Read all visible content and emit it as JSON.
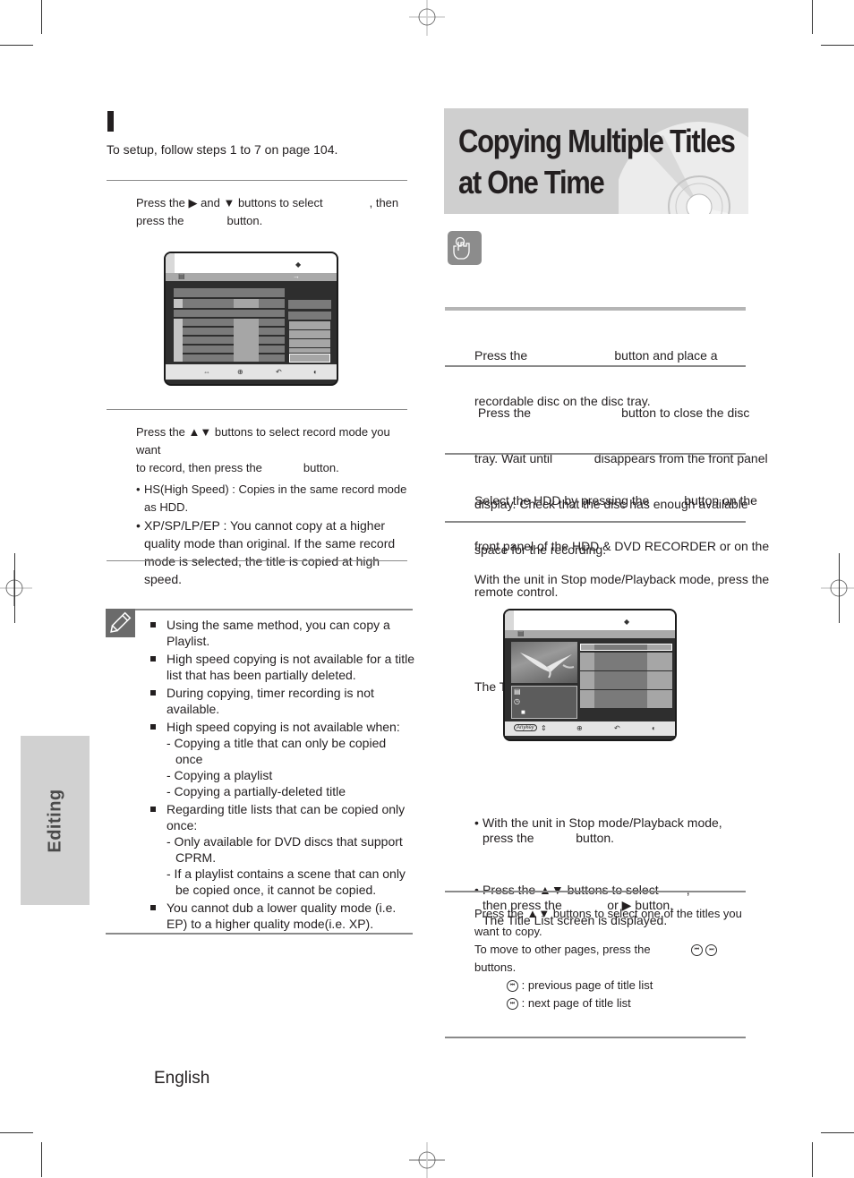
{
  "left_column": {
    "intro": "To setup, follow steps 1 to 7 on page 104.",
    "step_a": {
      "line1_pre": "Press the ",
      "line1_mid": " and ",
      "line1_post": " buttons to select",
      "line1_end": ", then",
      "line2_pre": "press the",
      "line2_post": "button."
    },
    "step_b": {
      "line1": "Press the ▲▼ buttons to select record mode you want",
      "line2_pre": "to record, then press the",
      "line2_post": "button.",
      "bullets": [
        {
          "dot": "•",
          "text": "HS(High Speed) : Copies in the same record mode as HDD."
        },
        {
          "dot": "•",
          "text": "XP/SP/LP/EP : You cannot copy at a higher quality mode than original. If the same record mode is selected, the title is copied at high speed."
        }
      ]
    },
    "notes": [
      {
        "text": "Using the same method, you can copy a Playlist.",
        "subs": []
      },
      {
        "text": "High speed copying is not available for a title list that has been partially deleted.",
        "subs": []
      },
      {
        "text": "During copying, timer recording is not available.",
        "subs": []
      },
      {
        "text": "High speed copying is not available when:",
        "subs": [
          "- Copying a title that can only be copied once",
          "- Copying a playlist",
          "- Copying a partially-deleted title"
        ]
      },
      {
        "text": "Regarding title lists that can be copied only once:",
        "subs": [
          "- Only available for DVD discs that support CPRM.",
          "- If a playlist contains a scene that can only be copied once, it cannot be copied."
        ]
      },
      {
        "text": "You cannot dub a lower quality mode (i.e. EP) to a higher quality mode(i.e. XP).",
        "subs": []
      }
    ],
    "note_icon": "pencil-icon"
  },
  "right_column": {
    "title": "Copying Multiple Titles at One Time",
    "title_line1": "Copying Multiple Titles",
    "title_line2": "at One Time",
    "hand_icon": "hand-press-icon",
    "steps": [
      {
        "lines": [
          "Press the                         button and place a",
          "recordable disc on the disc tray."
        ]
      },
      {
        "lines": [
          " Press the                          button to close the disc",
          "tray. Wait until            disappears from the front panel",
          "display. Check that the disc has enough available",
          "space for the recording."
        ]
      },
      {
        "lines": [
          "Select the HDD by pressing the          button on the",
          "front panel of the HDD & DVD RECORDER or on the",
          "remote control."
        ]
      },
      {
        "lines": [
          "With the unit in Stop mode/Playback mode, press the",
          "                 button.",
          "The Title List screen is displayed."
        ]
      }
    ],
    "alt_bullets": [
      {
        "dot": "•",
        "lines": [
          "With the unit in Stop mode/Playback mode,",
          "press the            button."
        ]
      },
      {
        "dot": "•",
        "lines": [
          "Press the ▲▼ buttons to select        ,",
          "then press the             or ▶ button.",
          "The Title List screen is displayed."
        ]
      }
    ],
    "final_step": {
      "lines": [
        "Press the ▲▼ buttons to select one of the titles you",
        "want to copy.",
        "To move to other pages, press the"
      ],
      "line_buttons": "buttons.",
      "prev_text": ": previous page of title list",
      "next_text": ": next page of title list"
    }
  },
  "side_tab": {
    "label": "Editing"
  },
  "footer": {
    "language": "English"
  },
  "screen1": {
    "footer_icons": [
      "move-icon",
      "ok-icon",
      "return-icon",
      "exit-icon"
    ]
  },
  "screen2": {
    "anykey_label": "Anykey",
    "footer_icons": [
      "anykey-icon",
      "updown-icon",
      "ok-icon",
      "return-icon",
      "exit-icon"
    ]
  }
}
